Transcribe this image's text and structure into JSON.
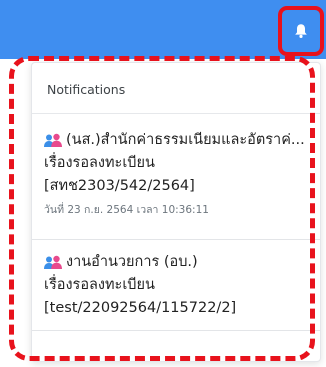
{
  "colors": {
    "topbar": "#3f8ef0",
    "highlight": "#e8121c",
    "icon_blue": "#3b8fe8",
    "icon_pink": "#e84a8d"
  },
  "topbar": {
    "bell_icon": "bell-icon"
  },
  "notifications": {
    "header": "Notifications",
    "items": [
      {
        "icon": "users-icon",
        "title": "(นส.)สำนักค่าธรรมเนียมและอัตราค่...",
        "status": "เรื่องรอลงทะเบียน",
        "code": "[สทช2303/542/2564]",
        "time": "วันที่ 23 ก.ย. 2564 เวลา 10:36:11"
      },
      {
        "icon": "users-icon",
        "title": "งานอำนวยการ (อบ.)",
        "status": "เรื่องรอลงทะเบียน",
        "code": "[test/22092564/115722/2]"
      }
    ]
  }
}
